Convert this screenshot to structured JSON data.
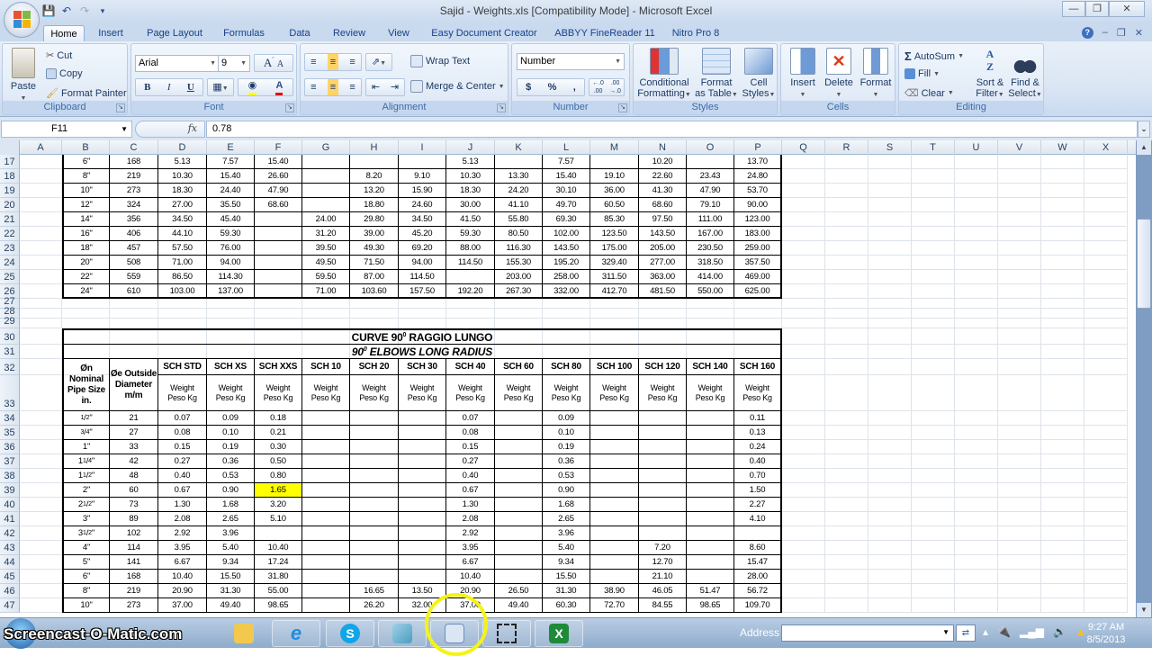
{
  "window": {
    "title": "Sajid - Weights.xls  [Compatibility Mode] - Microsoft Excel",
    "controls": [
      "minimize",
      "restore",
      "close"
    ]
  },
  "quick_access": [
    "save-icon",
    "undo-icon",
    "redo-icon",
    "customize-icon"
  ],
  "tabs": [
    {
      "label": "Home",
      "active": true
    },
    {
      "label": "Insert"
    },
    {
      "label": "Page Layout"
    },
    {
      "label": "Formulas"
    },
    {
      "label": "Data"
    },
    {
      "label": "Review"
    },
    {
      "label": "View"
    },
    {
      "label": "Easy Document Creator"
    },
    {
      "label": "ABBYY FineReader 11"
    },
    {
      "label": "Nitro Pro 8"
    }
  ],
  "ribbon": {
    "clipboard": {
      "label": "Clipboard",
      "paste": "Paste",
      "cut": "Cut",
      "copy": "Copy",
      "format_painter": "Format Painter"
    },
    "font": {
      "label": "Font",
      "font_name": "Arial",
      "font_size": "9",
      "bold": "B",
      "italic": "I",
      "underline": "U",
      "grow": "A",
      "shrink": "A"
    },
    "alignment": {
      "label": "Alignment",
      "wrap_text": "Wrap Text",
      "merge_center": "Merge & Center"
    },
    "number": {
      "label": "Number",
      "format": "Number",
      "currency": "$",
      "percent": "%",
      "comma": ",",
      "inc_decimal": "+.0 .00",
      "dec_decimal": ".00 +.0"
    },
    "styles": {
      "label": "Styles",
      "conditional_1": "Conditional",
      "conditional_2": "Formatting",
      "format_table_1": "Format",
      "format_table_2": "as Table",
      "cell_styles_1": "Cell",
      "cell_styles_2": "Styles"
    },
    "cells": {
      "label": "Cells",
      "insert": "Insert",
      "delete": "Delete",
      "format": "Format"
    },
    "editing": {
      "label": "Editing",
      "autosum": "AutoSum",
      "fill": "Fill",
      "clear": "Clear",
      "sort_1": "Sort &",
      "sort_2": "Filter",
      "find_1": "Find &",
      "find_2": "Select"
    }
  },
  "formula_bar": {
    "name_box": "F11",
    "fx": "fx",
    "value": "0.78"
  },
  "columns": [
    "A",
    "B",
    "C",
    "D",
    "E",
    "F",
    "G",
    "H",
    "I",
    "J",
    "K",
    "L",
    "M",
    "N",
    "O",
    "P",
    "Q",
    "R",
    "S",
    "T",
    "U",
    "V",
    "W",
    "X"
  ],
  "table1_rows": [
    {
      "row": "17",
      "cells": [
        "6\"",
        "168",
        "5.13",
        "7.57",
        "15.40",
        "",
        "",
        "",
        "5.13",
        "",
        "7.57",
        "",
        "10.20",
        "",
        "13.70"
      ]
    },
    {
      "row": "18",
      "cells": [
        "8\"",
        "219",
        "10.30",
        "15.40",
        "26.60",
        "",
        "8.20",
        "9.10",
        "10.30",
        "13.30",
        "15.40",
        "19.10",
        "22.60",
        "23.43",
        "24.80"
      ]
    },
    {
      "row": "19",
      "cells": [
        "10\"",
        "273",
        "18.30",
        "24.40",
        "47.90",
        "",
        "13.20",
        "15.90",
        "18.30",
        "24.20",
        "30.10",
        "36.00",
        "41.30",
        "47.90",
        "53.70"
      ]
    },
    {
      "row": "20",
      "cells": [
        "12\"",
        "324",
        "27.00",
        "35.50",
        "68.60",
        "",
        "18.80",
        "24.60",
        "30.00",
        "41.10",
        "49.70",
        "60.50",
        "68.60",
        "79.10",
        "90.00"
      ]
    },
    {
      "row": "21",
      "cells": [
        "14\"",
        "356",
        "34.50",
        "45.40",
        "",
        "24.00",
        "29.80",
        "34.50",
        "41.50",
        "55.80",
        "69.30",
        "85.30",
        "97.50",
        "111.00",
        "123.00"
      ]
    },
    {
      "row": "22",
      "cells": [
        "16\"",
        "406",
        "44.10",
        "59.30",
        "",
        "31.20",
        "39.00",
        "45.20",
        "59.30",
        "80.50",
        "102.00",
        "123.50",
        "143.50",
        "167.00",
        "183.00"
      ]
    },
    {
      "row": "23",
      "cells": [
        "18\"",
        "457",
        "57.50",
        "76.00",
        "",
        "39.50",
        "49.30",
        "69.20",
        "88.00",
        "116.30",
        "143.50",
        "175.00",
        "205.00",
        "230.50",
        "259.00"
      ]
    },
    {
      "row": "24",
      "cells": [
        "20\"",
        "508",
        "71.00",
        "94.00",
        "",
        "49.50",
        "71.50",
        "94.00",
        "114.50",
        "155.30",
        "195.20",
        "329.40",
        "277.00",
        "318.50",
        "357.50"
      ]
    },
    {
      "row": "25",
      "cells": [
        "22\"",
        "559",
        "86.50",
        "114.30",
        "",
        "59.50",
        "87.00",
        "114.50",
        "",
        "203.00",
        "258.00",
        "311.50",
        "363.00",
        "414.00",
        "469.00"
      ]
    },
    {
      "row": "26",
      "cells": [
        "24\"",
        "610",
        "103.00",
        "137.00",
        "",
        "71.00",
        "103.60",
        "157.50",
        "192.20",
        "267.30",
        "332.00",
        "412.70",
        "481.50",
        "550.00",
        "625.00"
      ]
    }
  ],
  "empty_rows": [
    "27",
    "28",
    "29"
  ],
  "table2": {
    "title_row": "30",
    "title_it": "CURVE 90",
    "title_it_sup": "0",
    "title_it_rest": " RAGGIO LUNGO",
    "subtitle_row": "31",
    "subtitle_en_num": "90",
    "subtitle_en_sup": "0",
    "subtitle_en_rest": " ELBOWS LONG RADIUS",
    "header_row": "32",
    "subheader_row": "33",
    "col_b_header": "Øn Nominal Pipe Size in.",
    "col_c_header": "Øe Outside Diameter m/m",
    "schedules": [
      "SCH STD",
      "SCH XS",
      "SCH XXS",
      "SCH 10",
      "SCH 20",
      "SCH 30",
      "SCH 40",
      "SCH 60",
      "SCH 80",
      "SCH 100",
      "SCH 120",
      "SCH 140",
      "SCH 160"
    ],
    "weight_label_1": "Weight",
    "weight_label_2": "Peso Kg",
    "rows": [
      {
        "row": "34",
        "cells": [
          "1/2\"",
          "21",
          "0.07",
          "0.09",
          "0.18",
          "",
          "",
          "",
          "0.07",
          "",
          "0.09",
          "",
          "",
          "",
          "0.11"
        ]
      },
      {
        "row": "35",
        "cells": [
          "3/4\"",
          "27",
          "0.08",
          "0.10",
          "0.21",
          "",
          "",
          "",
          "0.08",
          "",
          "0.10",
          "",
          "",
          "",
          "0.13"
        ]
      },
      {
        "row": "36",
        "cells": [
          "1\"",
          "33",
          "0.15",
          "0.19",
          "0.30",
          "",
          "",
          "",
          "0.15",
          "",
          "0.19",
          "",
          "",
          "",
          "0.24"
        ]
      },
      {
        "row": "37",
        "cells": [
          "1 1/4\"",
          "42",
          "0.27",
          "0.36",
          "0.50",
          "",
          "",
          "",
          "0.27",
          "",
          "0.36",
          "",
          "",
          "",
          "0.40"
        ]
      },
      {
        "row": "38",
        "cells": [
          "1 1/2\"",
          "48",
          "0.40",
          "0.53",
          "0.80",
          "",
          "",
          "",
          "0.40",
          "",
          "0.53",
          "",
          "",
          "",
          "0.70"
        ]
      },
      {
        "row": "39",
        "cells": [
          "2\"",
          "60",
          "0.67",
          "0.90",
          "1.65",
          "",
          "",
          "",
          "0.67",
          "",
          "0.90",
          "",
          "",
          "",
          "1.50"
        ],
        "highlight_col": 4
      },
      {
        "row": "40",
        "cells": [
          "2 1/2\"",
          "73",
          "1.30",
          "1.68",
          "3.20",
          "",
          "",
          "",
          "1.30",
          "",
          "1.68",
          "",
          "",
          "",
          "2.27"
        ]
      },
      {
        "row": "41",
        "cells": [
          "3\"",
          "89",
          "2.08",
          "2.65",
          "5.10",
          "",
          "",
          "",
          "2.08",
          "",
          "2.65",
          "",
          "",
          "",
          "4.10"
        ]
      },
      {
        "row": "42",
        "cells": [
          "3 1/2\"",
          "102",
          "2.92",
          "3.96",
          "",
          "",
          "",
          "",
          "2.92",
          "",
          "3.96",
          "",
          "",
          "",
          ""
        ]
      },
      {
        "row": "43",
        "cells": [
          "4\"",
          "114",
          "3.95",
          "5.40",
          "10.40",
          "",
          "",
          "",
          "3.95",
          "",
          "5.40",
          "",
          "7.20",
          "",
          "8.60"
        ]
      },
      {
        "row": "44",
        "cells": [
          "5\"",
          "141",
          "6.67",
          "9.34",
          "17.24",
          "",
          "",
          "",
          "6.67",
          "",
          "9.34",
          "",
          "12.70",
          "",
          "15.47"
        ]
      },
      {
        "row": "45",
        "cells": [
          "6\"",
          "168",
          "10.40",
          "15.50",
          "31.80",
          "",
          "",
          "",
          "10.40",
          "",
          "15.50",
          "",
          "21.10",
          "",
          "28.00"
        ]
      },
      {
        "row": "46",
        "cells": [
          "8\"",
          "219",
          "20.90",
          "31.30",
          "55.00",
          "",
          "16.65",
          "13.50",
          "20.90",
          "26.50",
          "31.30",
          "38.90",
          "46.05",
          "51.47",
          "56.72"
        ]
      },
      {
        "row": "47",
        "cells": [
          "10\"",
          "273",
          "37.00",
          "49.40",
          "98.65",
          "",
          "26.20",
          "32.00",
          "37.00",
          "49.40",
          "60.30",
          "72.70",
          "84.55",
          "98.65",
          "109.70"
        ]
      }
    ]
  },
  "highlight_color": "#ffff00",
  "taskbar": {
    "watermark": "Screencast-O-Matic.com",
    "apps": [
      "firefox-icon",
      "chrome-icon",
      "folder-icon",
      "internet-explorer-icon",
      "skype-icon",
      "notepad-icon",
      "calculator-icon",
      "snipping-tool-icon",
      "excel-icon"
    ],
    "address_label": "Address",
    "address_value": "",
    "time": "9:27 AM",
    "date": "8/5/2013"
  }
}
